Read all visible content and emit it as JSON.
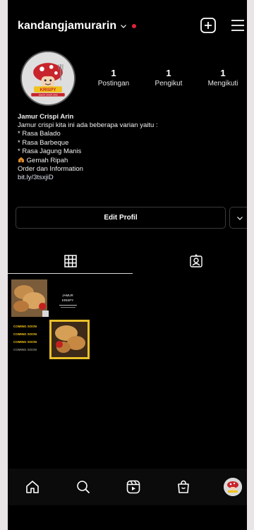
{
  "header": {
    "username": "kandangjamurarin",
    "new_post_icon": "plus-square-icon",
    "menu_icon": "hamburger-menu-icon"
  },
  "profile": {
    "logo_text": "KRISPY",
    "logo_subtext": "JAMUR CRISPI ARIN",
    "stats": [
      {
        "num": "1",
        "label": "Postingan"
      },
      {
        "num": "1",
        "label": "Pengikut"
      },
      {
        "num": "1",
        "label": "Mengikuti"
      }
    ],
    "bio": {
      "name": "Jamur Crispi Arin",
      "lines": [
        "Jamur crispi kita ini ada beberapa varian yaitu :",
        "* Rasa Balado",
        "* Rasa Barbeque",
        "* Rasa Jagung Manis"
      ],
      "location": "Gemah Ripah",
      "order": "Order dan Information",
      "link": "bit.ly/3tsxjiD"
    }
  },
  "buttons": {
    "edit_profile": "Edit Profil"
  },
  "tabs": [
    {
      "icon": "grid-icon",
      "active": true
    },
    {
      "icon": "tagged-person-icon",
      "active": false
    }
  ],
  "post": {
    "title_line1": "JAMUR",
    "title_line2": "KRISPY",
    "coming_soon": [
      "COMING SOON",
      "COMING SOON",
      "COMING SOON",
      "COMING SOON"
    ]
  },
  "nav": [
    {
      "icon": "home-icon"
    },
    {
      "icon": "search-icon"
    },
    {
      "icon": "reels-icon"
    },
    {
      "icon": "shop-icon"
    },
    {
      "icon": "profile-avatar-icon"
    }
  ],
  "colors": {
    "background": "#000000",
    "notification_dot": "#e0213a",
    "coming_soon": "#f5c518",
    "post_border": "#e9c02a"
  }
}
